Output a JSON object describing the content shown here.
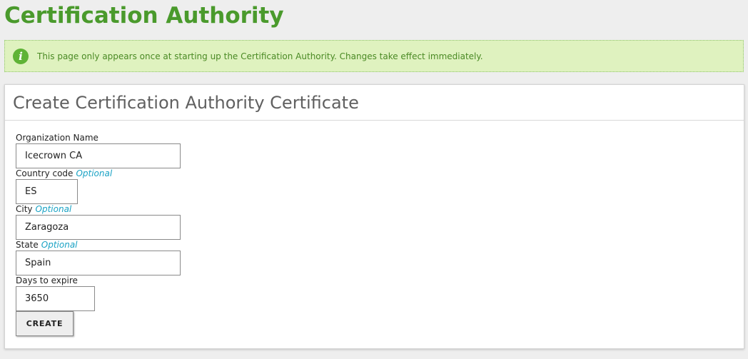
{
  "page": {
    "title": "Certification Authority"
  },
  "notice": {
    "icon": "info-icon",
    "icon_glyph": "i",
    "text": "This page only appears once at starting up the Certification Authority. Changes take effect immediately.",
    "color": "#dff2bf"
  },
  "form": {
    "title": "Create Certification Authority Certificate",
    "fields": [
      {
        "label": "Organization Name",
        "optional": "",
        "value": "Icecrown CA"
      },
      {
        "label": "Country code",
        "optional": "Optional",
        "value": "ES"
      },
      {
        "label": "City",
        "optional": "Optional",
        "value": "Zaragoza"
      },
      {
        "label": "State",
        "optional": "Optional",
        "value": "Spain"
      },
      {
        "label": "Days to expire",
        "optional": "",
        "value": "3650"
      }
    ],
    "submit_label": "CREATE"
  },
  "colors": {
    "title_green": "#4a9a2c",
    "optional_cyan": "#1aa2c4",
    "notice_text": "#4a8a24"
  }
}
